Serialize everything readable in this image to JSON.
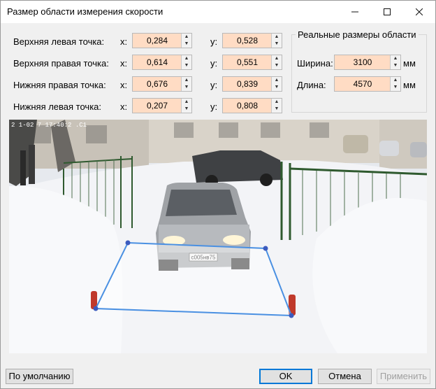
{
  "window": {
    "title": "Размер области измерения скорости"
  },
  "points": [
    {
      "label": "Верхняя левая точка:",
      "x": "0,284",
      "y": "0,528"
    },
    {
      "label": "Верхняя правая точка:",
      "x": "0,614",
      "y": "0,551"
    },
    {
      "label": "Нижняя правая точка:",
      "x": "0,676",
      "y": "0,839"
    },
    {
      "label": "Нижняя левая точка:",
      "x": "0,207",
      "y": "0,808"
    }
  ],
  "axis_labels": {
    "x": "x:",
    "y": "y:"
  },
  "real_size": {
    "title": "Реальные размеры области",
    "width_label": "Ширина:",
    "width_value": "3100",
    "length_label": "Длина:",
    "length_value": "4570",
    "unit": "мм"
  },
  "video": {
    "timestamp": "2 1-02 7 17:40:2 .C1",
    "plate": "с005нв75"
  },
  "buttons": {
    "default": "По умолчанию",
    "ok": "OK",
    "cancel": "Отмена",
    "apply": "Применить"
  }
}
